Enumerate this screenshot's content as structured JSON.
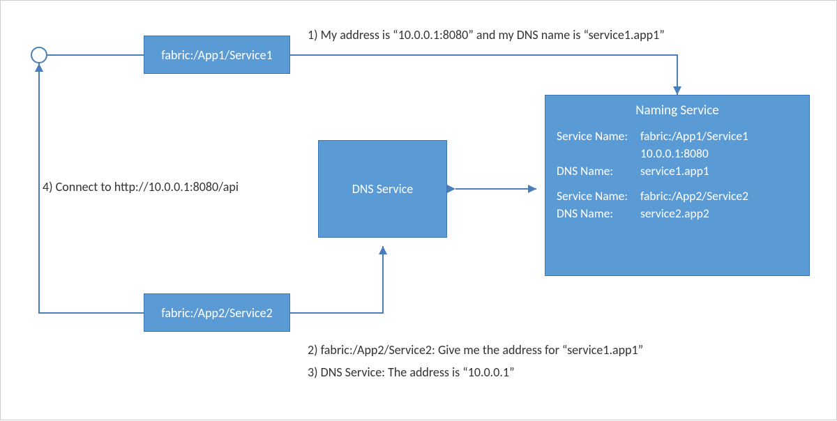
{
  "boxes": {
    "service1": "fabric:/App1/Service1",
    "service2": "fabric:/App2/Service2",
    "dns": "DNS Service"
  },
  "naming": {
    "title": "Naming Service",
    "entries": [
      {
        "service_name": "fabric:/App1/Service1",
        "address": "10.0.0.1:8080",
        "dns_name": "service1.app1"
      },
      {
        "service_name": "fabric:/App2/Service2",
        "dns_name": "service2.app2"
      }
    ],
    "labels": {
      "service_name": "Service Name:",
      "dns_name": "DNS Name:"
    }
  },
  "steps": {
    "s1": "1) My address is “10.0.0.1:8080” and my DNS name is “service1.app1”",
    "s2": "2) fabric:/App2/Service2: Give me the address for “service1.app1”",
    "s3": "3) DNS Service: The address is “10.0.0.1”",
    "s4": "4) Connect to http://10.0.0.1:8080/api"
  },
  "colors": {
    "box_fill": "#5b9bd5",
    "box_border": "#3b75b5",
    "arrow": "#4a7ebb",
    "text": "#333333"
  }
}
